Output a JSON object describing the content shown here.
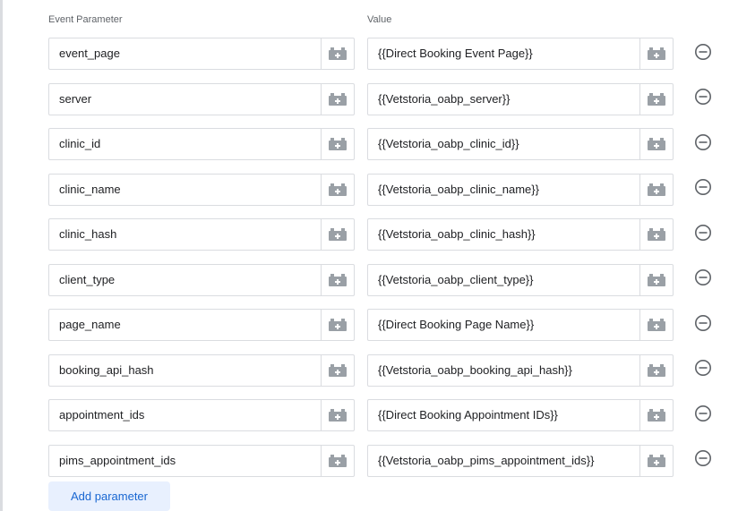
{
  "headers": {
    "param": "Event Parameter",
    "value": "Value"
  },
  "rows": [
    {
      "param": "event_page",
      "value": "{{Direct Booking Event Page}}"
    },
    {
      "param": "server",
      "value": "{{Vetstoria_oabp_server}}"
    },
    {
      "param": "clinic_id",
      "value": "{{Vetstoria_oabp_clinic_id}}"
    },
    {
      "param": "clinic_name",
      "value": "{{Vetstoria_oabp_clinic_name}}"
    },
    {
      "param": "clinic_hash",
      "value": "{{Vetstoria_oabp_clinic_hash}}"
    },
    {
      "param": "client_type",
      "value": "{{Vetstoria_oabp_client_type}}"
    },
    {
      "param": "page_name",
      "value": "{{Direct Booking Page Name}}"
    },
    {
      "param": "booking_api_hash",
      "value": "{{Vetstoria_oabp_booking_api_hash}}"
    },
    {
      "param": "appointment_ids",
      "value": "{{Direct Booking Appointment IDs}}"
    },
    {
      "param": "pims_appointment_ids",
      "value": "{{Vetstoria_oabp_pims_appointment_ids}}"
    }
  ],
  "icons": {
    "variable": "variable-picker-icon",
    "remove": "remove-circle-icon"
  },
  "colors": {
    "accent": "#1967d2",
    "accent_bg": "#e8f0fe",
    "border": "#dadce0",
    "icon": "#9aa0a6"
  },
  "add_button": "Add parameter"
}
